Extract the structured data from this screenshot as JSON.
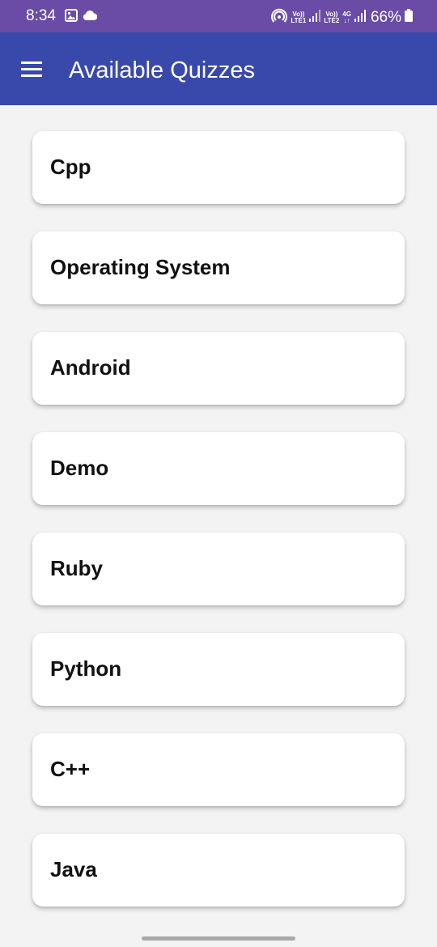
{
  "status_bar": {
    "time": "8:34",
    "sim1_top": "Vo))",
    "sim1_bottom": "LTE1",
    "sim2_top": "Vo))",
    "sim2_bottom": "LTE2",
    "net_type": "4G",
    "battery": "66%"
  },
  "app_bar": {
    "title": "Available Quizzes"
  },
  "quizzes": [
    {
      "label": "Cpp"
    },
    {
      "label": "Operating System"
    },
    {
      "label": "Android"
    },
    {
      "label": "Demo"
    },
    {
      "label": "Ruby"
    },
    {
      "label": "Python"
    },
    {
      "label": "C++"
    },
    {
      "label": "Java"
    }
  ],
  "colors": {
    "status_bar": "#6a4ca6",
    "app_bar": "#3949ab",
    "background": "#f3f3f3",
    "card": "#ffffff"
  }
}
